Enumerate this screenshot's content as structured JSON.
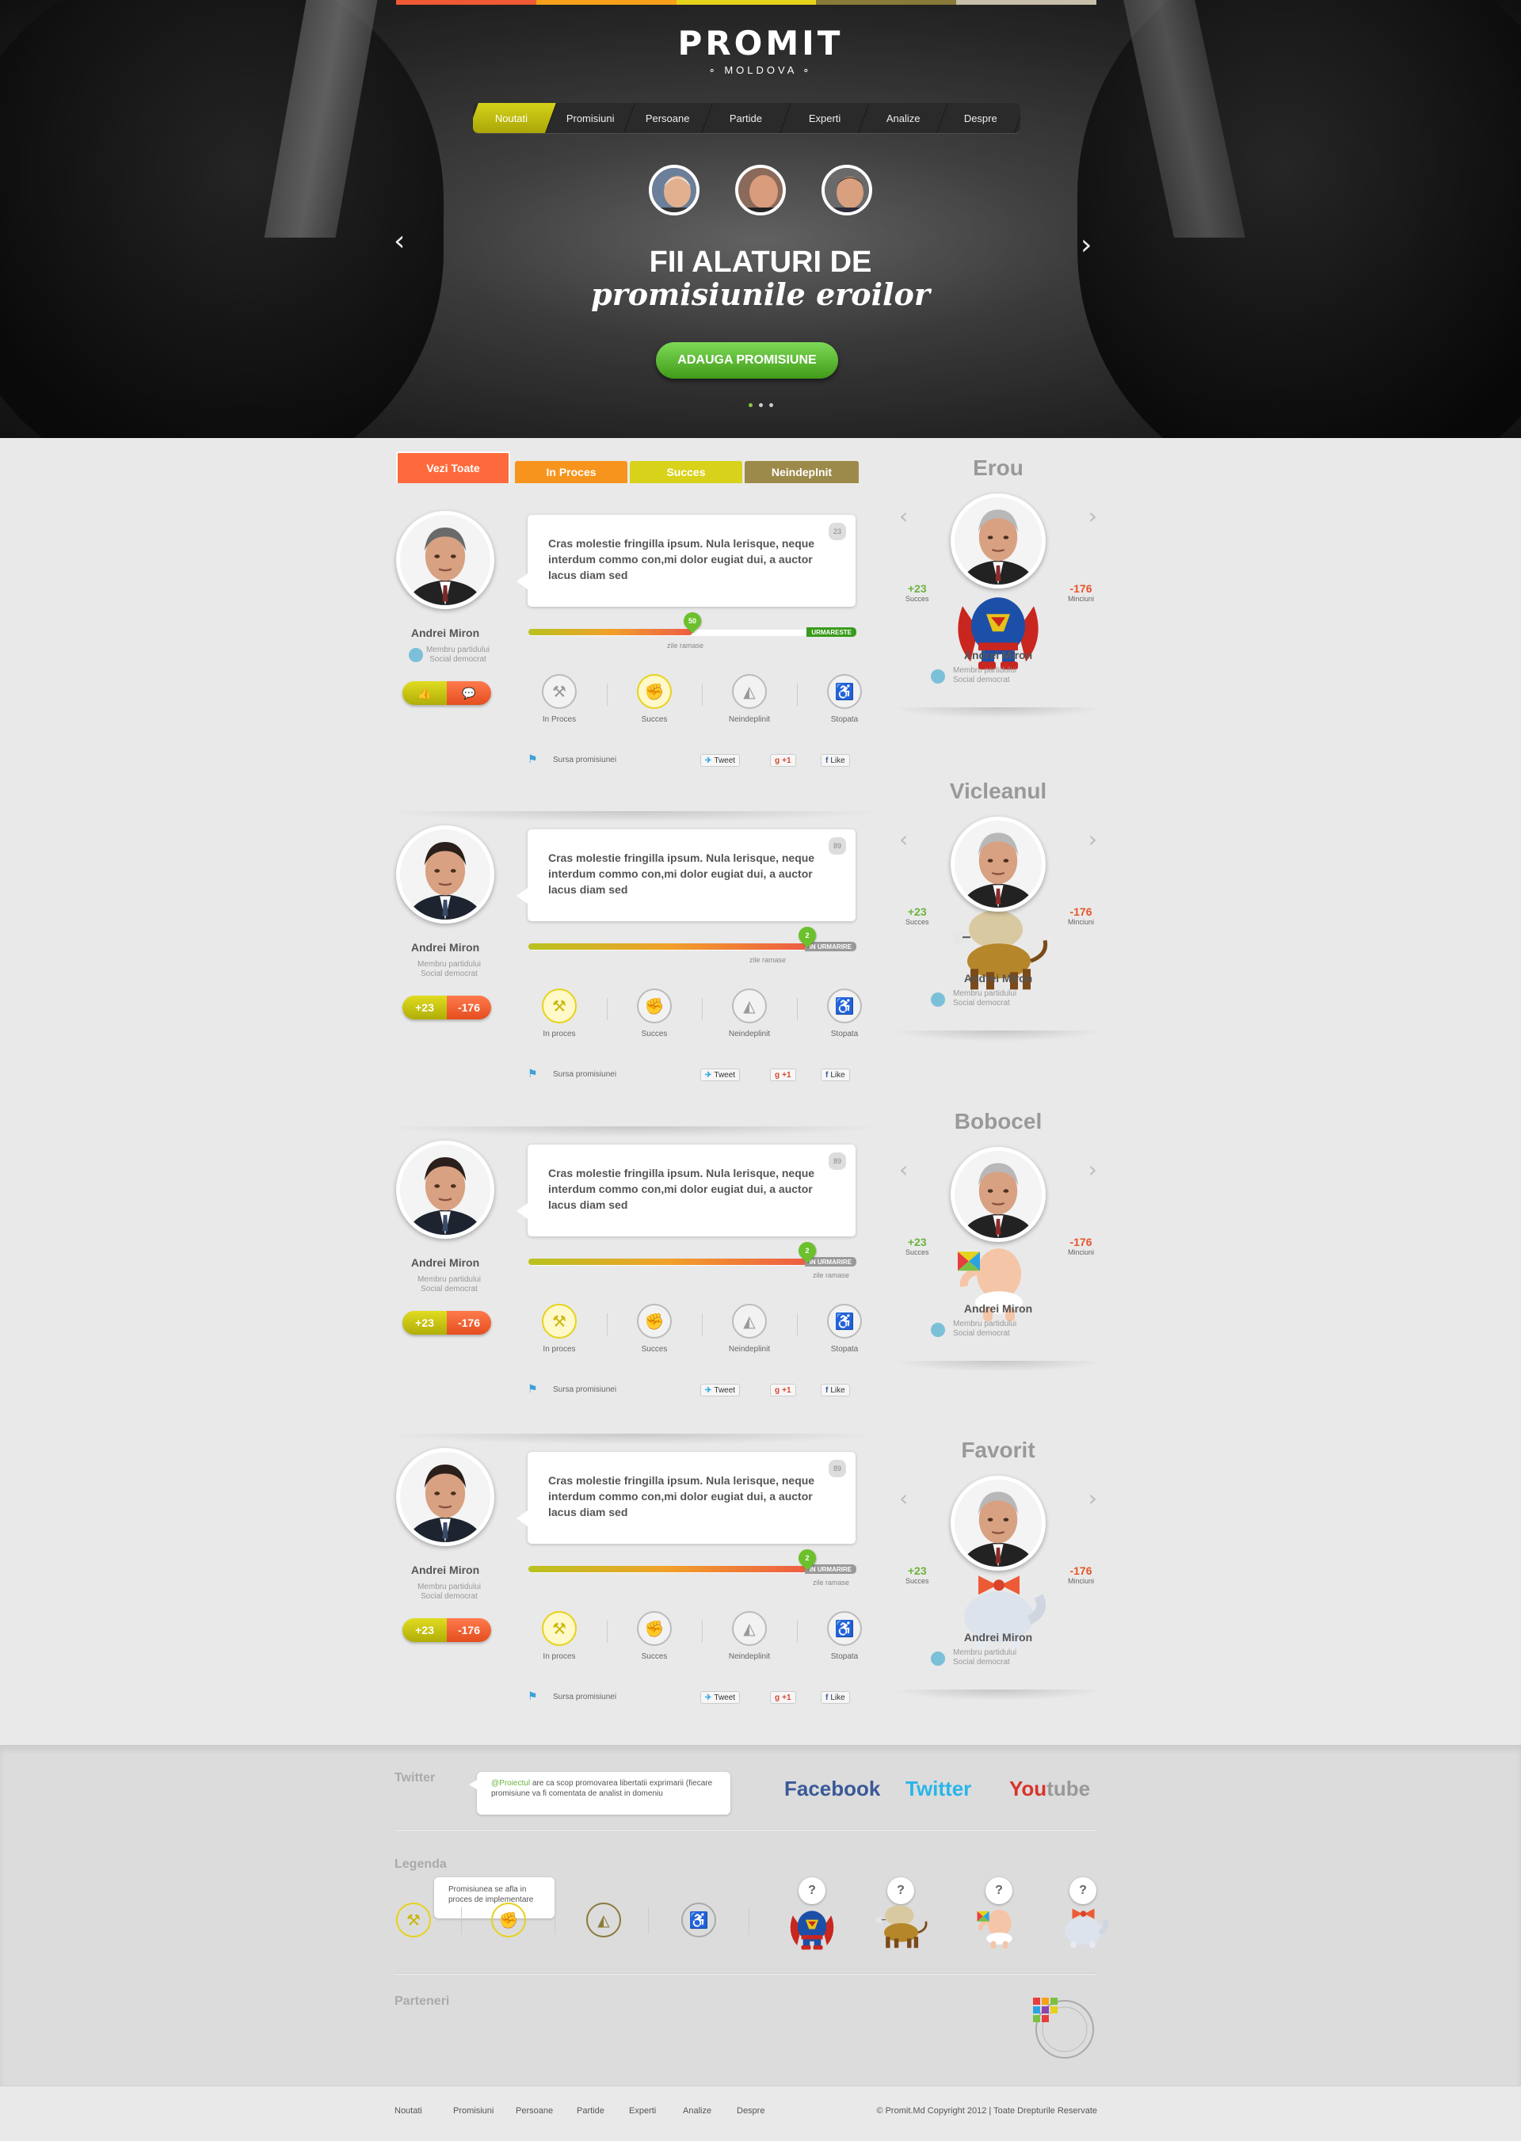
{
  "brand": {
    "name": "PROMIT",
    "sub": "∘ MOLDOVA ∘"
  },
  "top_bar_colors": [
    "#ee5a35",
    "#f7a11a",
    "#e5d21a",
    "#8a7a3a",
    "#c7bfa9"
  ],
  "nav": [
    "Noutati",
    "Promisiuni",
    "Persoane",
    "Partide",
    "Experti",
    "Analize",
    "Despre"
  ],
  "hero": {
    "line1": "FII ALATURI DE",
    "line2": "promisiunile eroilor",
    "cta": "ADAUGA PROMISIUNE",
    "slide_count": 3,
    "active_slide": 1
  },
  "filters": [
    {
      "label": "Vezi Toate",
      "color": "#ff6a3c"
    },
    {
      "label": "In Proces",
      "color": "#f7941d"
    },
    {
      "label": "Succes",
      "color": "#d8d21a"
    },
    {
      "label": "Neindeplnit",
      "color": "#9c8a4a"
    }
  ],
  "feed": [
    {
      "name": "Andrei Miron",
      "meta": "Membru partidului\nSocial democrat",
      "text": "Cras molestie fringilla ipsum. Nula lerisque, neque interdum commo con,mi dolor eugiat dui, a auctor lacus diam sed",
      "count": "23",
      "progress": 0.5,
      "pin": "50",
      "status_label": "URMARESTE",
      "days_label": "zile ramase",
      "votes_up": "",
      "votes_down": "",
      "active_status": 1
    },
    {
      "name": "Andrei Miron",
      "meta": "Membru partidului\nSocial democrat",
      "text": "Cras molestie fringilla ipsum. Nula lerisque, neque interdum commo con,mi dolor eugiat dui, a auctor lacus diam sed",
      "count": "89",
      "progress": 0.85,
      "pin": "2",
      "status_label": "IN URMARIRE",
      "days_label": "zile ramase",
      "votes_up": "+23",
      "votes_down": "-176",
      "active_status": 0
    },
    {
      "name": "Andrei Miron",
      "meta": "Membru partidului\nSocial democrat",
      "text": "Cras molestie fringilla ipsum. Nula lerisque, neque interdum commo con,mi dolor eugiat dui, a auctor lacus diam sed",
      "count": "89",
      "progress": 0.85,
      "pin": "2",
      "status_label": "IN URMARIRE",
      "days_label": "zile ramase",
      "votes_up": "+23",
      "votes_down": "-176",
      "active_status": 0
    },
    {
      "name": "Andrei Miron",
      "meta": "Membru partidului\nSocial democrat",
      "text": "Cras molestie fringilla ipsum. Nula lerisque, neque interdum commo con,mi dolor eugiat dui, a auctor lacus diam sed",
      "count": "89",
      "progress": 0.85,
      "pin": "2",
      "status_label": "IN URMARIRE",
      "days_label": "zile ramase",
      "votes_up": "+23",
      "votes_down": "-176",
      "active_status": 0
    }
  ],
  "status_labels_first": [
    "In Proces",
    "Succes",
    "Neindeplinit",
    "Stopata"
  ],
  "status_labels": [
    "In proces",
    "Succes",
    "Neindeplinit",
    "Stopata"
  ],
  "social": {
    "source": "Sursa promisiunei",
    "tweet": "Tweet",
    "gplus": "+1",
    "like": "Like"
  },
  "heroes": [
    {
      "title": "Erou",
      "name": "Andrei Miron",
      "meta": "Membru partidului\nSocial democrat",
      "succes": "+23",
      "succes_label": "Succes",
      "minciuni": "-176",
      "minciuni_label": "Minciuni",
      "costume": "superman"
    },
    {
      "title": "Vicleanul",
      "name": "Andrei Miron",
      "meta": "Membru partidului\nSocial democrat",
      "succes": "+23",
      "succes_label": "Succes",
      "minciuni": "-176",
      "minciuni_label": "Minciuni",
      "costume": "lion"
    },
    {
      "title": "Bobocel",
      "name": "Andrei Miron",
      "meta": "Membru partidului\nSocial democrat",
      "succes": "+23",
      "succes_label": "Succes",
      "minciuni": "-176",
      "minciuni_label": "Minciuni",
      "costume": "baby"
    },
    {
      "title": "Favorit",
      "name": "Andrei Miron",
      "meta": "Membru partidului\nSocial democrat",
      "succes": "+23",
      "succes_label": "Succes",
      "minciuni": "-176",
      "minciuni_label": "Minciuni",
      "costume": "cat"
    }
  ],
  "twitter": {
    "heading": "Twitter",
    "handle": "@Proiectul",
    "text": " are ca scop promovarea libertatii exprimarii (fiecare promisiune va fi comentata de analist in domeniu"
  },
  "social_links": {
    "facebook": "Facebook",
    "twitter": "Twitter",
    "youtube_you": "You",
    "youtube_tube": "tube",
    "colors": {
      "facebook": "#3b5998",
      "twitter": "#29b6e8",
      "youtube": "#d9332b",
      "tube": "#999999"
    }
  },
  "legend": {
    "heading": "Legenda",
    "tooltip": "Promisiunea se afla in proces de implementare",
    "help": "?"
  },
  "partners": {
    "heading": "Parteneri"
  },
  "footer": {
    "nav": [
      "Noutati",
      "Promisiuni",
      "Persoane",
      "Partide",
      "Experti",
      "Analize",
      "Despre"
    ],
    "copyright": "© Promit.Md  Copyright 2012  |  Toate Drepturile Reservate"
  }
}
